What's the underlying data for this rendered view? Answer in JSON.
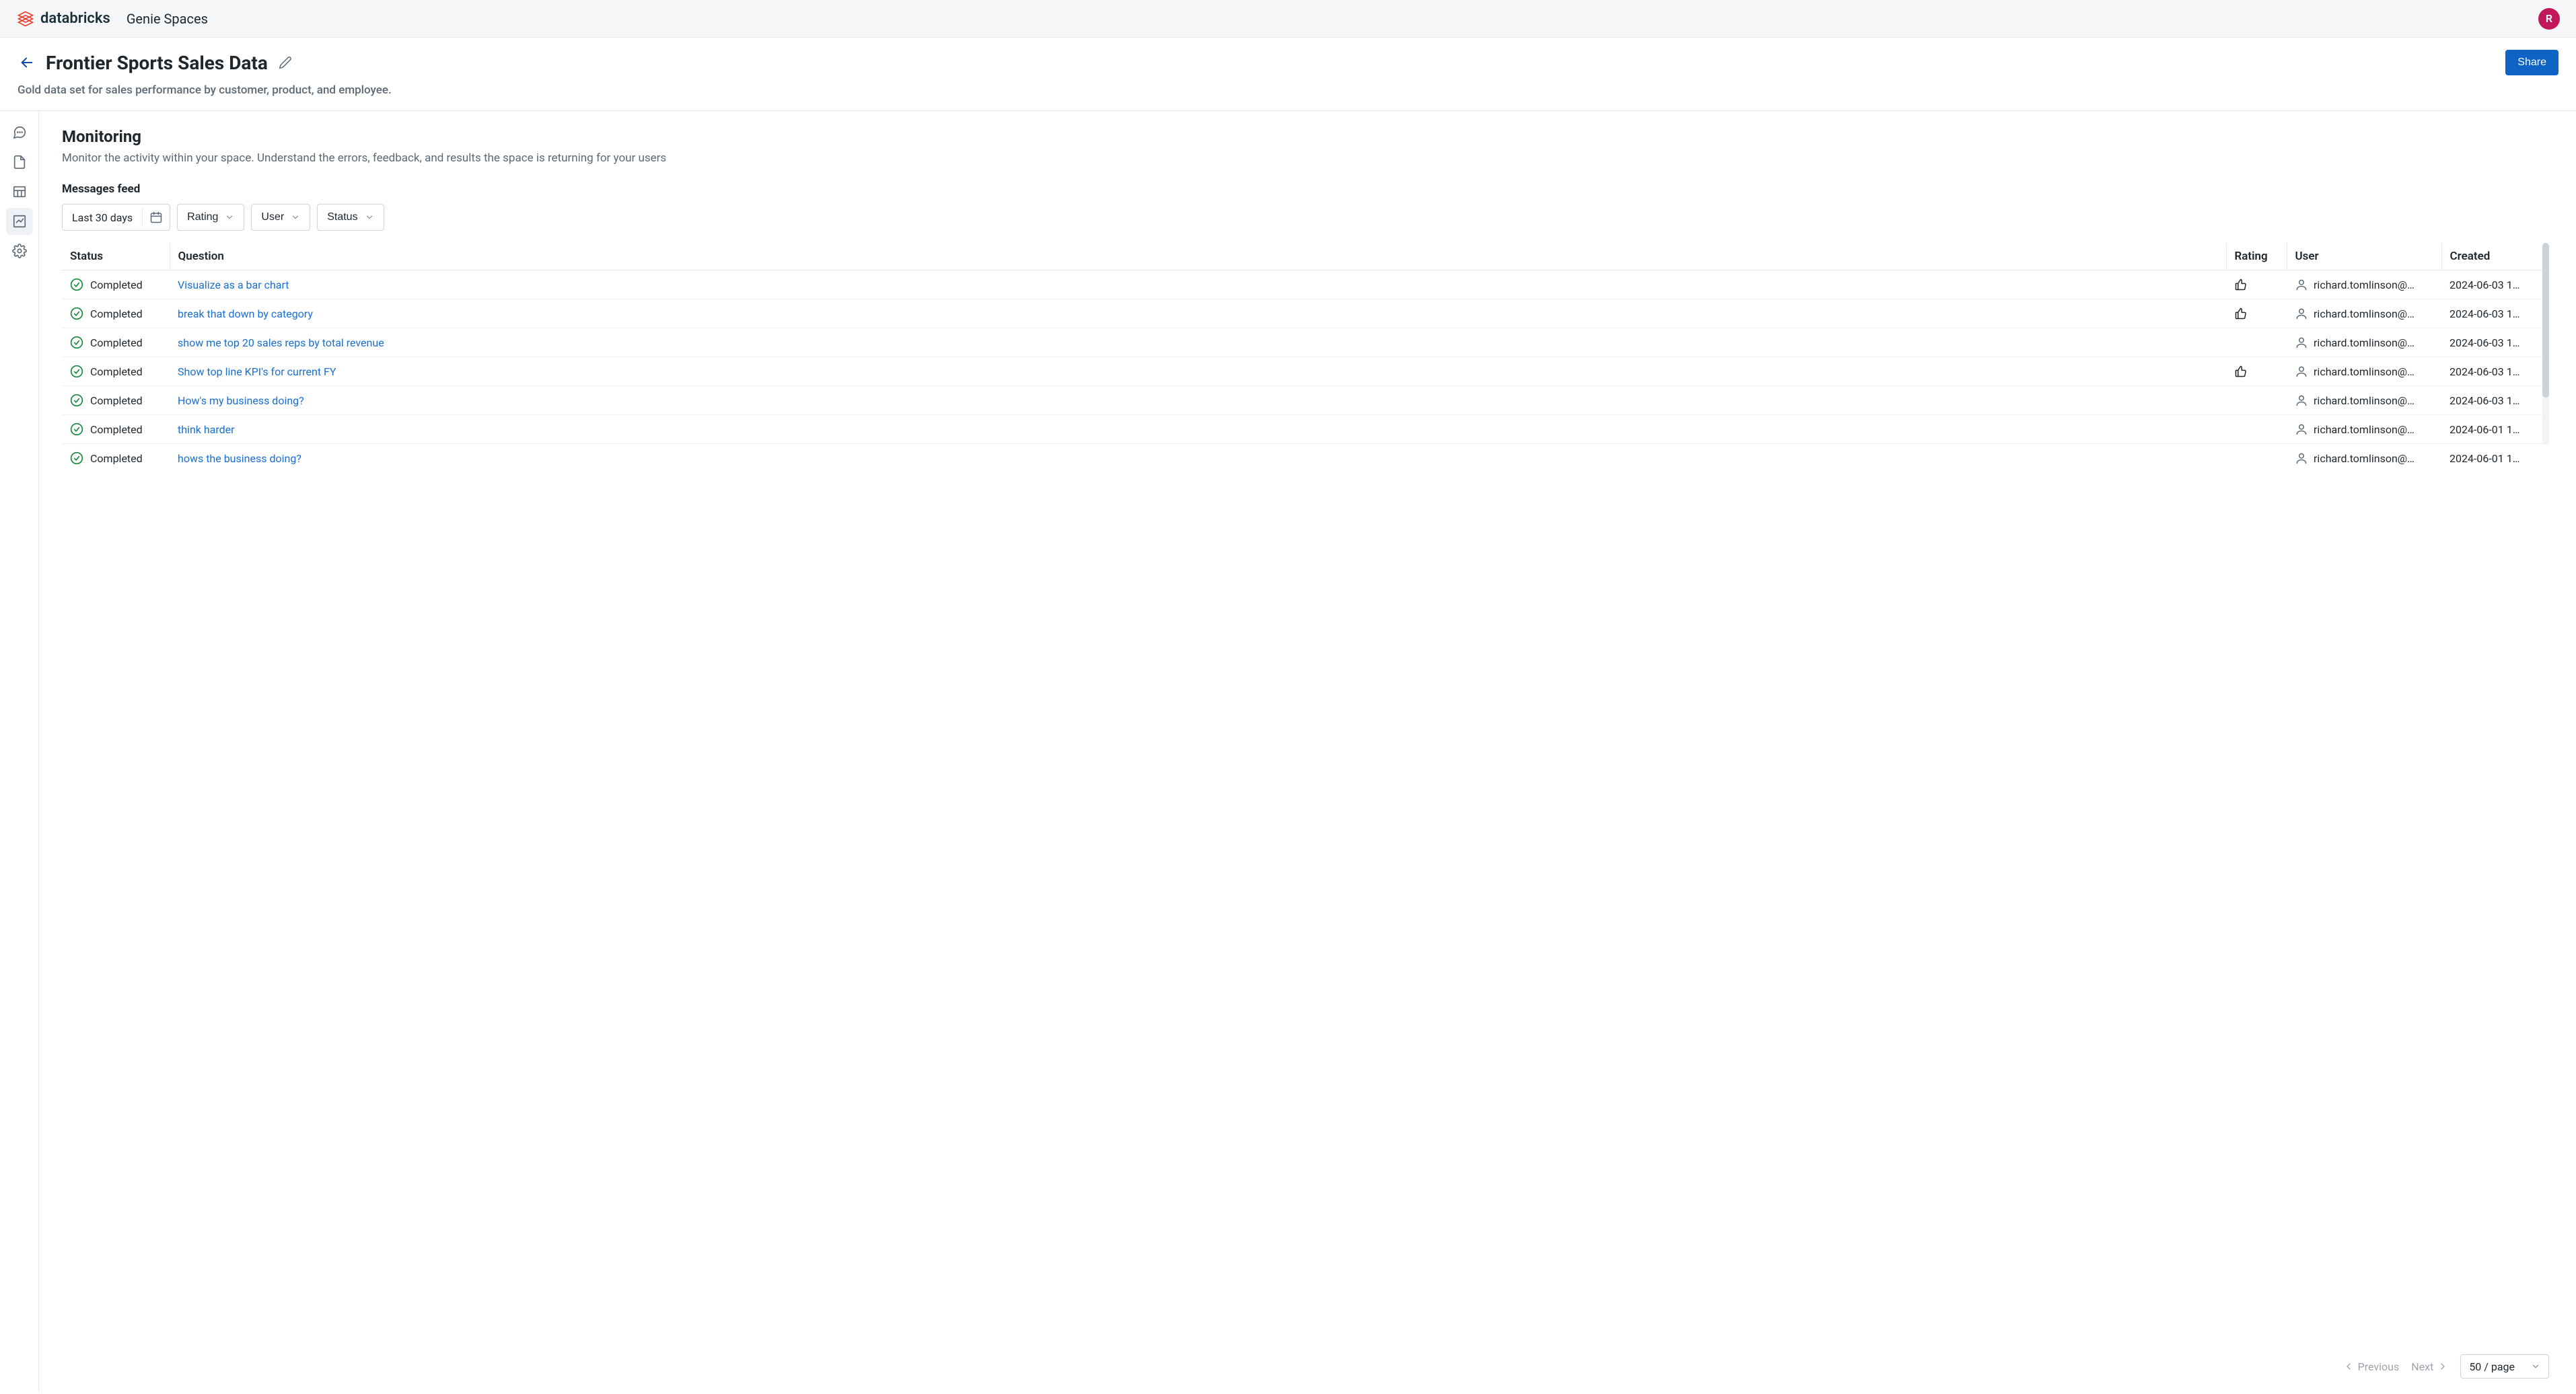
{
  "topbar": {
    "brand": "databricks",
    "section": "Genie Spaces",
    "avatar_initial": "R"
  },
  "page": {
    "title": "Frontier Sports Sales Data",
    "description": "Gold data set for sales performance by customer, product, and employee.",
    "share_label": "Share"
  },
  "monitoring": {
    "title": "Monitoring",
    "description": "Monitor the activity within your space. Understand the errors, feedback, and results the space is returning for your users",
    "feed_label": "Messages feed"
  },
  "filters": {
    "date_range": "Last 30 days",
    "rating": "Rating",
    "user": "User",
    "status": "Status"
  },
  "table": {
    "headers": {
      "status": "Status",
      "question": "Question",
      "rating": "Rating",
      "user": "User",
      "created": "Created"
    },
    "rows": [
      {
        "status": "Completed",
        "question": "Visualize as a bar chart",
        "rating": "up",
        "user": "richard.tomlinson@…",
        "created": "2024-06-03 1…"
      },
      {
        "status": "Completed",
        "question": "break that down by category",
        "rating": "up",
        "user": "richard.tomlinson@…",
        "created": "2024-06-03 1…"
      },
      {
        "status": "Completed",
        "question": "show me top 20 sales reps by total revenue",
        "rating": "",
        "user": "richard.tomlinson@…",
        "created": "2024-06-03 1…"
      },
      {
        "status": "Completed",
        "question": "Show top line KPI's for current FY",
        "rating": "up",
        "user": "richard.tomlinson@…",
        "created": "2024-06-03 1…"
      },
      {
        "status": "Completed",
        "question": "How's my business doing?",
        "rating": "",
        "user": "richard.tomlinson@…",
        "created": "2024-06-03 1…"
      },
      {
        "status": "Completed",
        "question": "think harder",
        "rating": "",
        "user": "richard.tomlinson@…",
        "created": "2024-06-01 1…"
      },
      {
        "status": "Completed",
        "question": "hows the business doing?",
        "rating": "",
        "user": "richard.tomlinson@…",
        "created": "2024-06-01 1…"
      }
    ]
  },
  "pager": {
    "prev": "Previous",
    "next": "Next",
    "page_size": "50 / page"
  }
}
